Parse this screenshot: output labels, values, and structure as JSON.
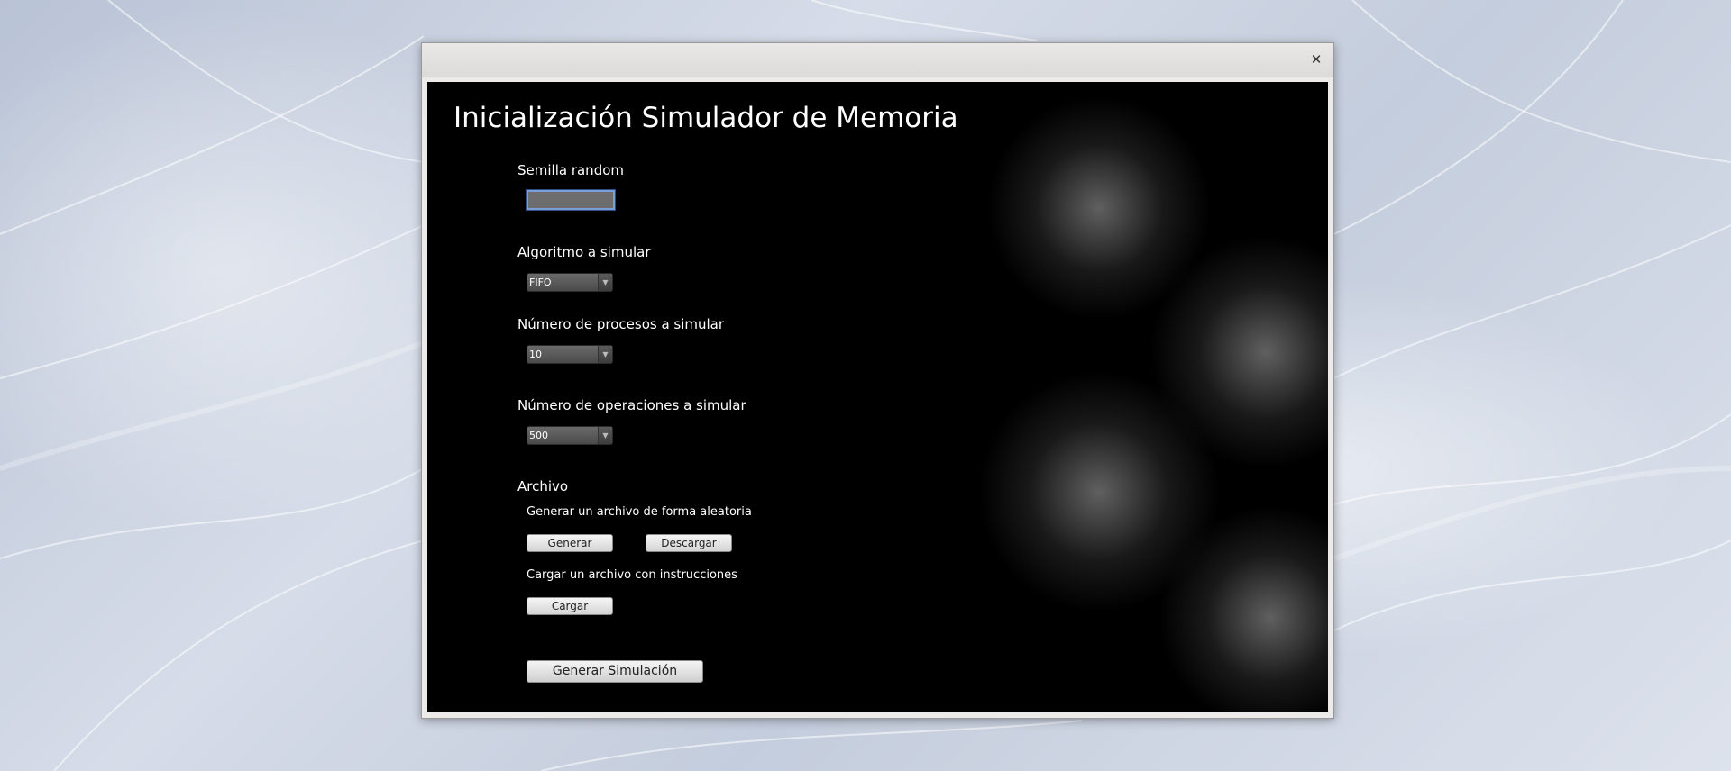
{
  "window": {
    "close_label": "✕"
  },
  "form": {
    "title": "Inicialización Simulador de Memoria",
    "seed": {
      "label": "Semilla random",
      "value": ""
    },
    "algorithm": {
      "label": "Algoritmo a simular",
      "selected": "FIFO"
    },
    "processes": {
      "label": "Número de procesos a simular",
      "selected": "10"
    },
    "operations": {
      "label": "Número de operaciones a simular",
      "selected": "500"
    },
    "file": {
      "label": "Archivo",
      "generate_text": "Generar un archivo de forma aleatoria",
      "generate_button": "Generar",
      "download_button": "Descargar",
      "load_text": "Cargar un archivo con instrucciones",
      "load_button": "Cargar"
    },
    "submit_button": "Generar Simulación"
  },
  "icons": {
    "dropdown_arrow": "▼"
  }
}
